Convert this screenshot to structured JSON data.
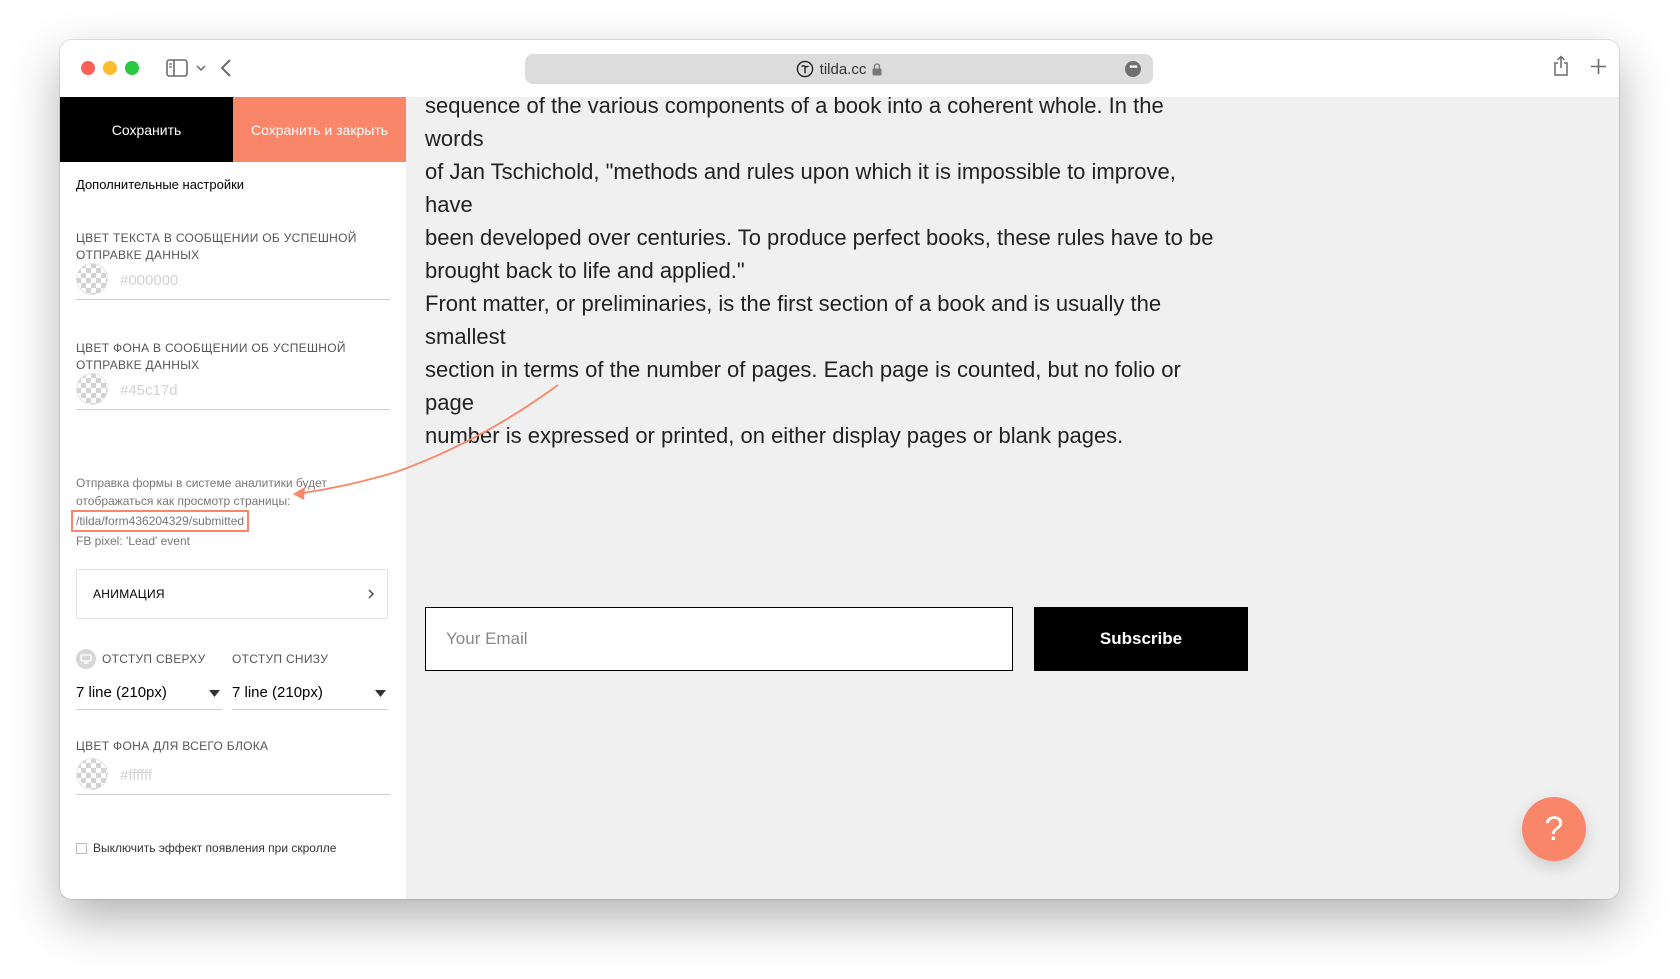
{
  "browser": {
    "url": "tilda.cc"
  },
  "panel": {
    "save_label": "Сохранить",
    "save_close_label": "Сохранить и закрыть",
    "title": "Дополнительные настройки",
    "success_text_color": {
      "label_line1": "Цвет текста в сообщении об успешной",
      "label_line2": "отправке данных",
      "placeholder": "#000000"
    },
    "success_bg_color": {
      "label_line1": "Цвет фона в сообщении об успешной",
      "label_line2": "отправке данных",
      "placeholder": "#45c17d"
    },
    "analytics": {
      "line1": "Отправка формы в системе аналитики будет",
      "line2": "отображаться как просмотр страницы:",
      "path": "/tilda/form436204329/submitted",
      "fb_pixel": "FB pixel: 'Lead' event"
    },
    "animation_label": "АНИМАЦИЯ",
    "padding_top": {
      "label": "Отступ сверху",
      "value": "7 line (210px)"
    },
    "padding_bottom": {
      "label": "Отступ снизу",
      "value": "7 line (210px)"
    },
    "block_bg_color": {
      "label": "Цвет фона для всего блока",
      "placeholder": "#ffffff"
    },
    "scroll_checkbox_label": "Выключить эффект появления при скролле"
  },
  "main": {
    "paragraph1": [
      "sequence of the various components of a book into a coherent whole. In the words",
      "of Jan Tschichold, \"methods and rules upon which it is impossible to improve, have",
      "been developed over centuries. To produce perfect books, these rules have to be",
      "brought back to life and applied.\""
    ],
    "paragraph2": [
      "Front matter, or preliminaries, is the first section of a book and is usually the smallest",
      "section in terms of the number of pages. Each page is counted, but no folio or page",
      "number is expressed or printed, on either display pages or blank pages."
    ],
    "email_placeholder": "Your Email",
    "subscribe_label": "Subscribe",
    "help_label": "?"
  },
  "colors": {
    "accent": "#fa8669",
    "dark_button": "#000000",
    "canvas_bg": "#f0f0f0"
  }
}
